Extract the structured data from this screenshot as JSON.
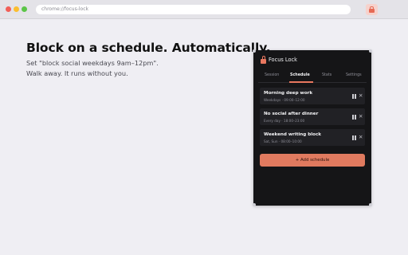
{
  "browser": {
    "url": "chrome://focus-lock"
  },
  "hero": {
    "headline": "Block on a schedule. Automatically.",
    "sub_line1": "Set \"block social weekdays 9am–12pm\".",
    "sub_line2": "Walk away. It runs without you."
  },
  "popup": {
    "title": "Focus Lock",
    "tabs": [
      {
        "label": "Session"
      },
      {
        "label": "Schedule"
      },
      {
        "label": "Stats"
      },
      {
        "label": "Settings"
      }
    ],
    "active_tab": "Schedule",
    "schedules": [
      {
        "title": "Morning deep work",
        "subtitle": "Weekdays · 09:00–12:00"
      },
      {
        "title": "No social after dinner",
        "subtitle": "Every day · 18:00–23:00"
      },
      {
        "title": "Weekend writing block",
        "subtitle": "Sat, Sun · 08:00–10:00"
      }
    ],
    "add_label": "+ Add schedule"
  },
  "colors": {
    "accent": "#e8775f",
    "popup_bg": "#151517",
    "page_bg": "#efeef3"
  },
  "icons": {
    "extension": "lock-icon",
    "row_actions": [
      "pause-icon",
      "close-icon"
    ]
  }
}
